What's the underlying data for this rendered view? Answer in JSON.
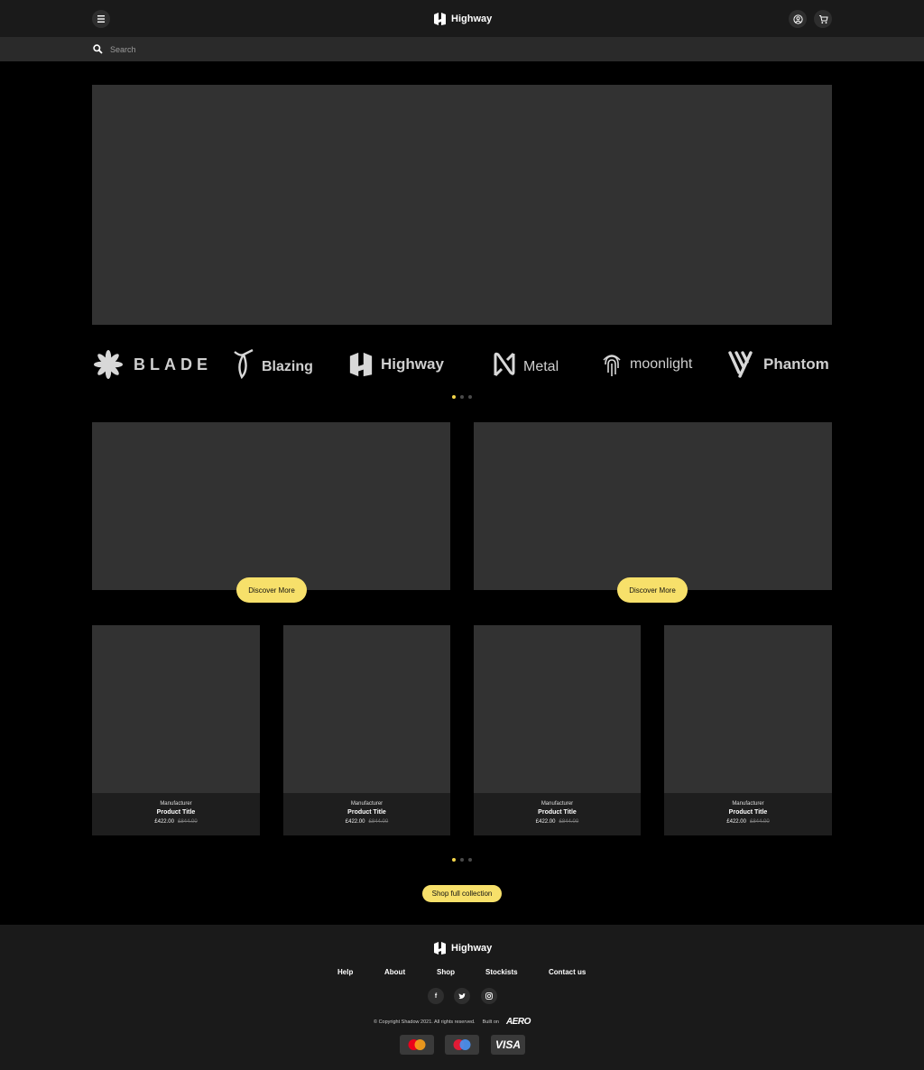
{
  "header": {
    "brand": "Highway",
    "icons": {
      "menu": "menu-icon",
      "account": "user-circle-icon",
      "cart": "cart-icon"
    }
  },
  "search": {
    "placeholder": "Search"
  },
  "brands": [
    {
      "name": "BLADE",
      "icon": "flower-icon"
    },
    {
      "name": "Blazing",
      "icon": "leaf-icon"
    },
    {
      "name": "Highway",
      "icon": "highway-logo-icon"
    },
    {
      "name": "Metal",
      "icon": "metal-logo-icon"
    },
    {
      "name": "moonlight",
      "icon": "fingerprint-icon"
    },
    {
      "name": "Phantom",
      "icon": "phantom-logo-icon"
    }
  ],
  "promos": [
    {
      "cta": "Discover More"
    },
    {
      "cta": "Discover More"
    }
  ],
  "products": [
    {
      "manufacturer": "Manufacturer",
      "title": "Product Title",
      "price": "£422.00",
      "old_price": "£844.00"
    },
    {
      "manufacturer": "Manufacturer",
      "title": "Product Title",
      "price": "£422.00",
      "old_price": "£844.00"
    },
    {
      "manufacturer": "Manufacturer",
      "title": "Product Title",
      "price": "£422.00",
      "old_price": "£844.00"
    },
    {
      "manufacturer": "Manufacturer",
      "title": "Product Title",
      "price": "£422.00",
      "old_price": "£844.00"
    }
  ],
  "shop_cta": "Shop full collection",
  "footer": {
    "brand": "Highway",
    "nav": [
      "Help",
      "About",
      "Shop",
      "Stockists",
      "Contact us"
    ],
    "social": [
      "facebook-icon",
      "twitter-icon",
      "instagram-icon"
    ],
    "copyright": "© Copyright Shadow 2021. All rights reserved.",
    "built_on": "Built on",
    "built_on_brand": "AERO",
    "payments": [
      "mastercard-icon",
      "maestro-icon",
      "VISA"
    ]
  },
  "colors": {
    "accent": "#f7e06a",
    "placeholder": "#323232",
    "header_bg": "#1a1a1a"
  }
}
